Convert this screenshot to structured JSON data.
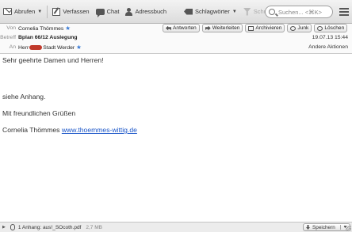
{
  "toolbar": {
    "get_mail": "Abrufen",
    "compose": "Verfassen",
    "chat": "Chat",
    "address_book": "Adressbuch",
    "tags": "Schlagwörter",
    "quick_filter": "Schnellfilter",
    "search_placeholder": "Suchen... <⌘K>"
  },
  "header": {
    "from_label": "Von",
    "from_value": "Cornelia Thömmes",
    "subject_label": "Betreff",
    "subject_value": "Bplan 66/12 Auslegung",
    "to_label": "An",
    "to_prefix": "Herr",
    "to_suffix": "Stadt Werder",
    "date": "19.07.13 15:44",
    "other_actions": "Andere Aktionen",
    "actions": {
      "reply": "Antworten",
      "forward": "Weiterleiten",
      "archive": "Archivieren",
      "junk": "Junk",
      "delete": "Löschen"
    }
  },
  "message": {
    "greeting": "Sehr geehrte Damen und Herren!",
    "line1": "siehe Anhang.",
    "closing": "Mit freundlichen Grüßen",
    "signature_name": "Cornelia Thömmes",
    "signature_link": "www.thoemmes-wittig.de"
  },
  "attachment": {
    "summary": "1 Anhang: aus!_SOcoth.pdf",
    "size": "2,7 MB",
    "save_label": "Speichern"
  }
}
